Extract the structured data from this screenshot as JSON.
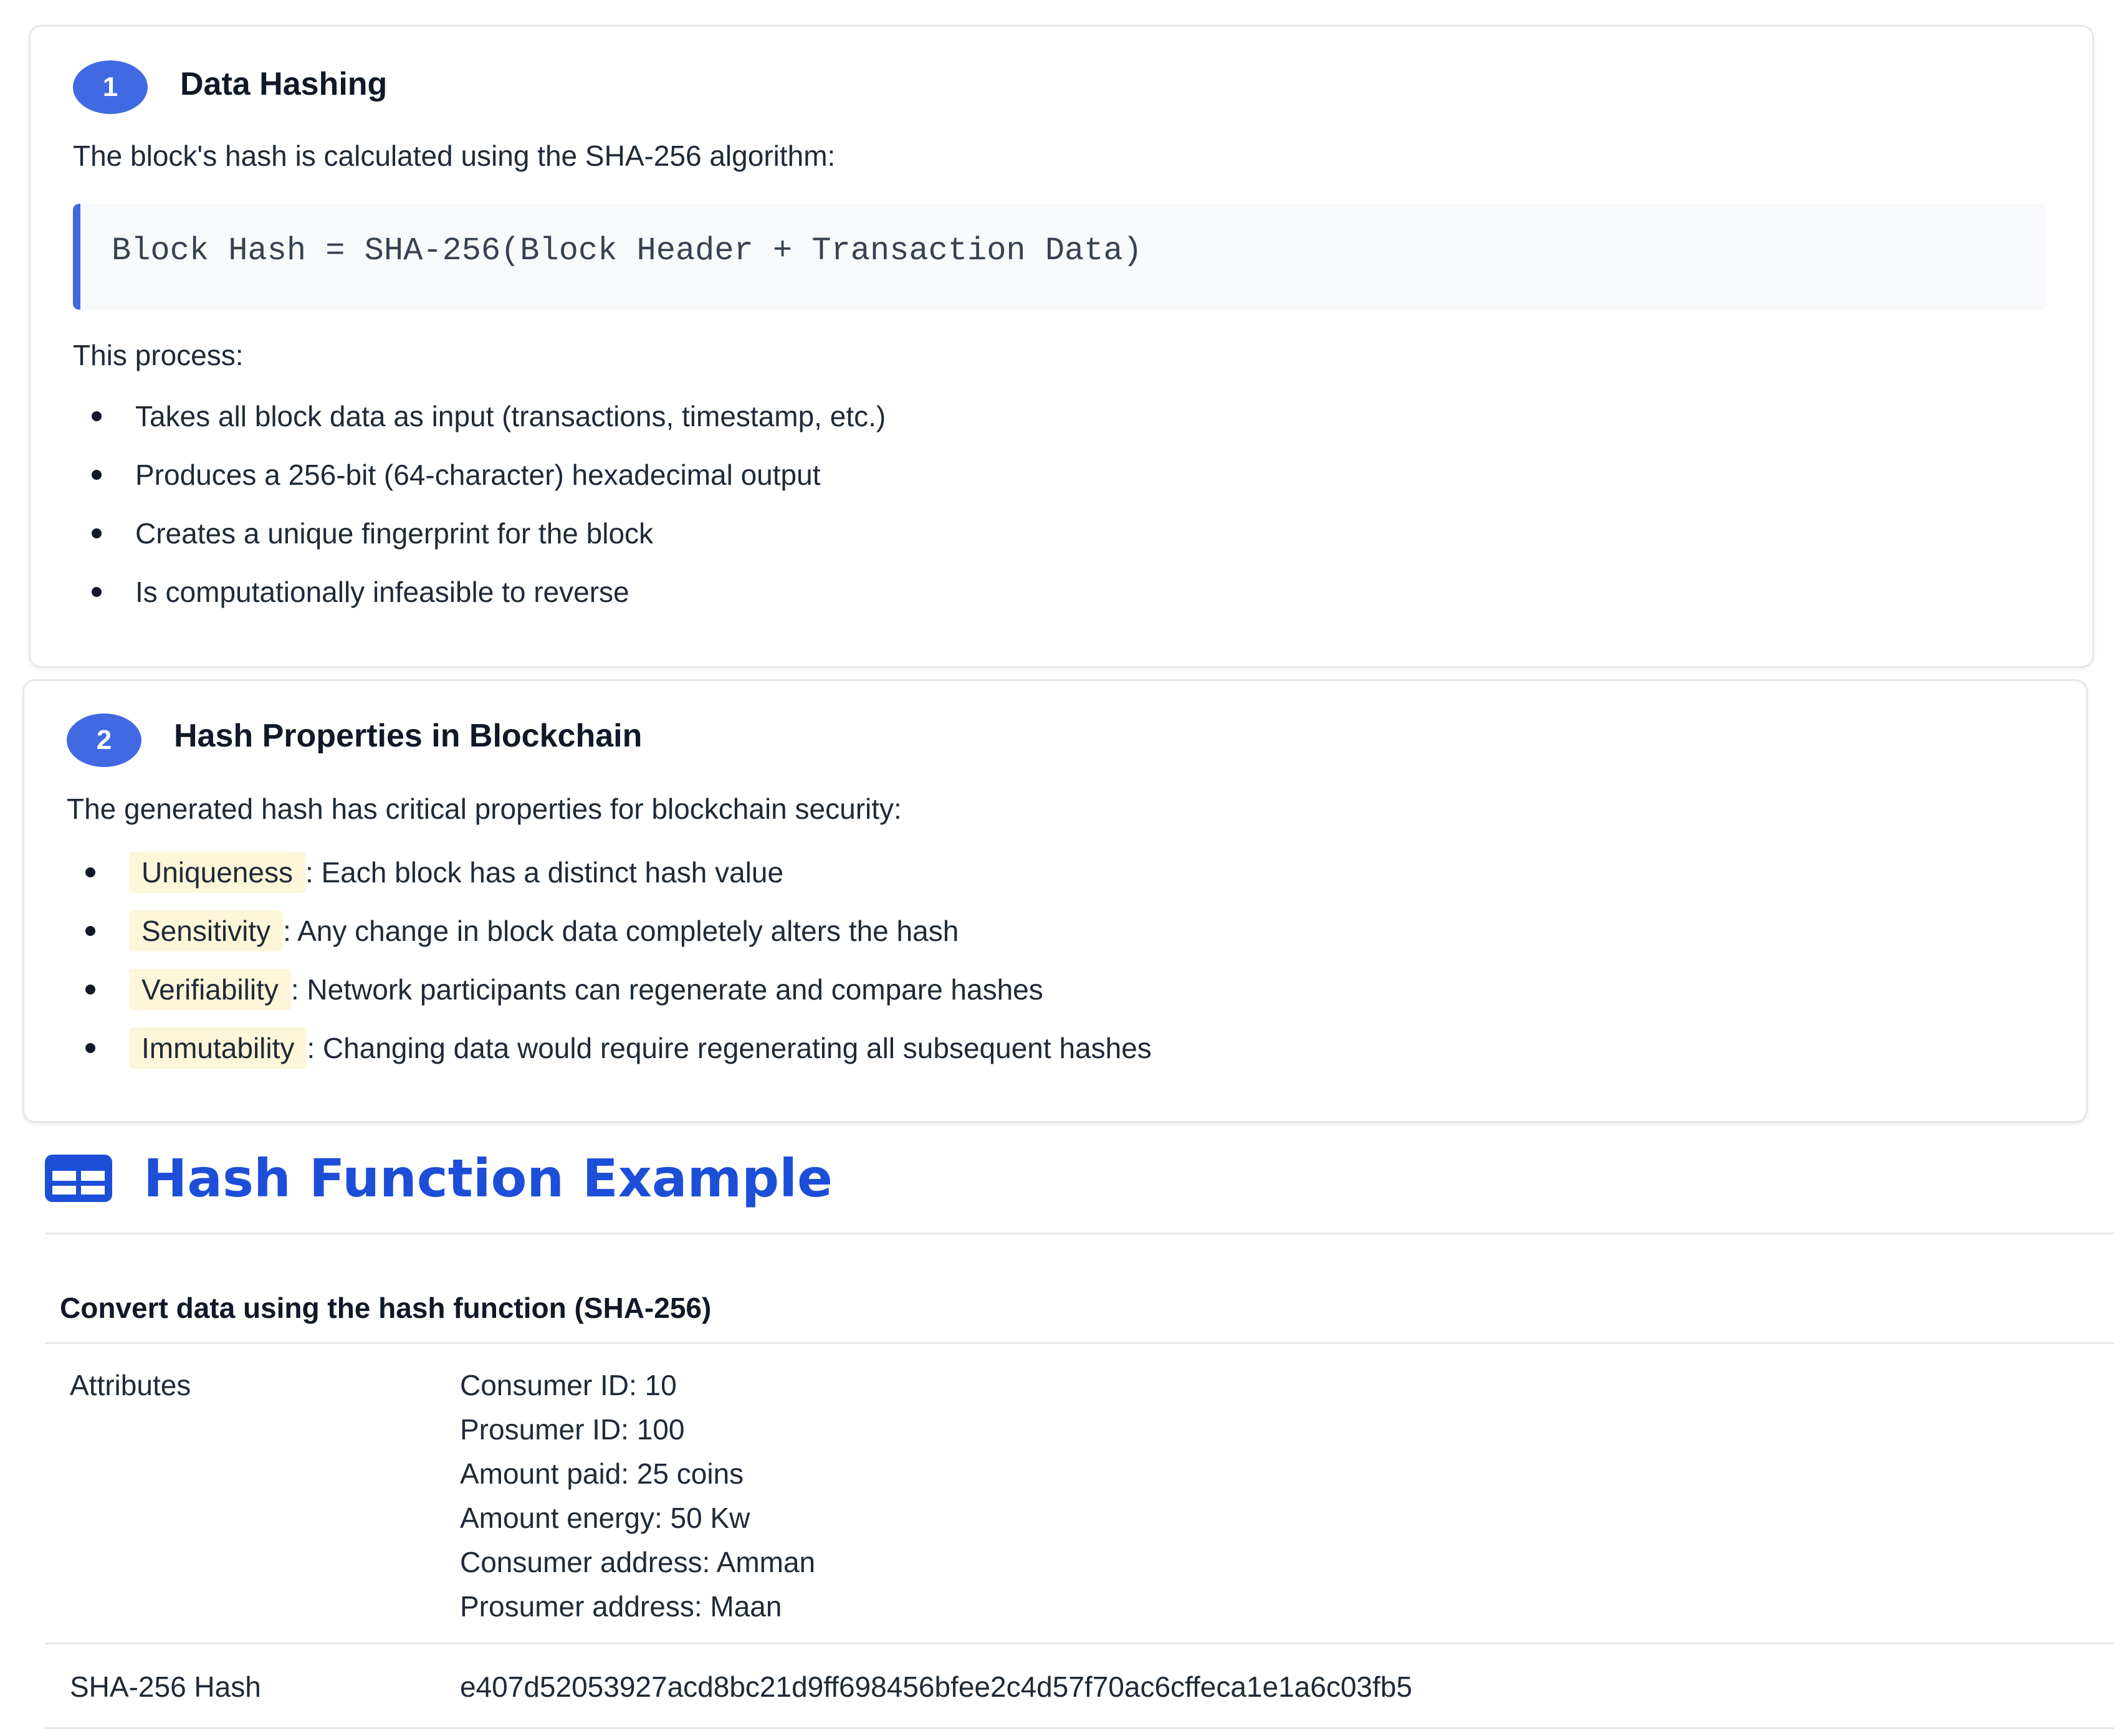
{
  "steps": [
    {
      "number": "1",
      "title": "Data Hashing",
      "intro": "The block's hash is calculated using the SHA-256 algorithm:",
      "formula": "Block Hash = SHA-256(Block Header + Transaction Data)",
      "process_label": "This process:",
      "items": [
        "Takes all block data as input (transactions, timestamp, etc.)",
        "Produces a 256-bit (64-character) hexadecimal output",
        "Creates a unique fingerprint for the block",
        "Is computationally infeasible to reverse"
      ]
    },
    {
      "number": "2",
      "title": "Hash Properties in Blockchain",
      "intro": "The generated hash has critical properties for blockchain security:",
      "properties": [
        {
          "term": "Uniqueness",
          "desc": ": Each block has a distinct hash value"
        },
        {
          "term": "Sensitivity",
          "desc": ": Any change in block data completely alters the hash"
        },
        {
          "term": "Verifiability",
          "desc": ": Network participants can regenerate and compare hashes"
        },
        {
          "term": "Immutability",
          "desc": ": Changing data would require regenerating all subsequent hashes"
        }
      ]
    }
  ],
  "example": {
    "heading": "Hash Function Example",
    "icon": "table-icon",
    "table_title": "Convert data using the hash function (SHA-256)",
    "attributes_label": "Attributes",
    "attributes": [
      "Consumer ID: 10",
      "Prosumer ID: 100",
      "Amount paid: 25 coins",
      "Amount energy: 50 Kw",
      "Consumer address: Amman",
      "Prosumer address: Maan"
    ],
    "hash_label": "SHA-256 Hash",
    "hash_value": "e407d52053927acd8bc21d9ff698456bfee2c4d57f70ac6cffeca1e1a6c03fb5"
  },
  "colors": {
    "accent": "#4169e1",
    "heading_blue": "#1d4ed8",
    "term_highlight": "#fdf6d8",
    "border": "#e5e7eb"
  }
}
